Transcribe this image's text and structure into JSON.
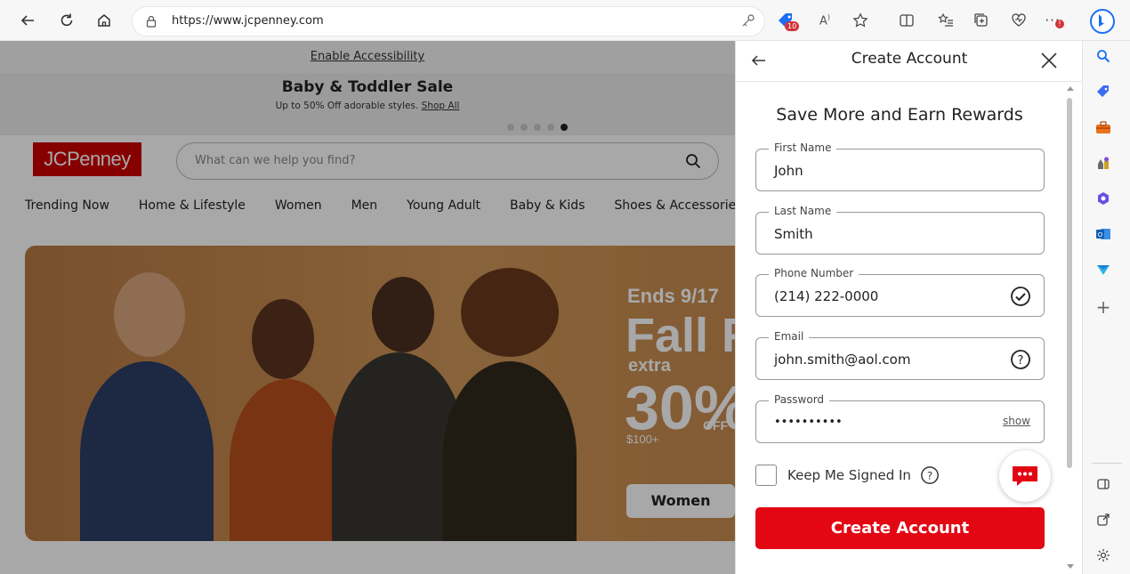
{
  "browser": {
    "url": "https://www.jcpenney.com",
    "edge_badge": "10"
  },
  "site": {
    "accessibility_link": "Enable Accessibility",
    "promo_title": "Baby & Toddler Sale",
    "promo_subtitle": "Up to 50% Off adorable styles.",
    "promo_link": "Shop All",
    "logo": "JCPenney",
    "search_placeholder": "What can we help you find?",
    "categories": [
      "Trending Now",
      "Home & Lifestyle",
      "Women",
      "Men",
      "Young Adult",
      "Baby & Kids",
      "Shoes & Accessories"
    ],
    "hero": {
      "ends": "Ends 9/17",
      "headline": "Fall F",
      "extra": "extra",
      "percent": "30%",
      "off": "OFF",
      "minimum": "$100+",
      "cta": "Women"
    }
  },
  "panel": {
    "title": "Create Account",
    "heading": "Save More and Earn Rewards",
    "fields": [
      {
        "label": "First Name",
        "value": "John"
      },
      {
        "label": "Last Name",
        "value": "Smith"
      },
      {
        "label": "Phone Number",
        "value": "(214) 222-0000"
      },
      {
        "label": "Email",
        "value": "john.smith@aol.com"
      },
      {
        "label": "Password",
        "value": "••••••••••"
      }
    ],
    "show_label": "show",
    "keep_signed_in": "Keep Me Signed In",
    "submit": "Create Account"
  },
  "colors": {
    "brand_red": "#e30613",
    "logo_red": "#cc0000",
    "edge_blue": "#1b6ef3"
  }
}
